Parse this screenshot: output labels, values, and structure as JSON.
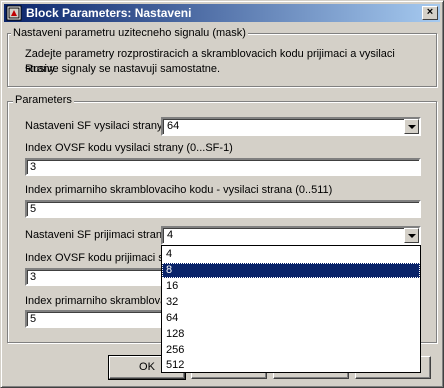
{
  "window": {
    "title": "Block Parameters: Nastaveni",
    "close_glyph": "×"
  },
  "mask": {
    "legend": "Nastaveni parametru uzitecneho signalu (mask)",
    "description_line1": "Zadejte parametry rozprostiracich a skramblovacich kodu prijimaci a vysilaci strany.",
    "description_line2": "Rusive signaly se nastavuji samostatne."
  },
  "parameters": {
    "legend": "Parameters",
    "sf_tx": {
      "label": "Nastaveni SF vysilaci strany",
      "value": "64"
    },
    "ovsf_tx": {
      "label": "Index OVSF kodu vysilaci strany (0...SF-1)",
      "value": "3"
    },
    "scr_tx": {
      "label": "Index primarniho skramblovaciho  kodu - vysilaci strana (0..511)",
      "value": "5"
    },
    "sf_rx": {
      "label": "Nastaveni SF prijimaci strany",
      "value": "4"
    },
    "ovsf_rx": {
      "label": "Index OVSF kodu prijimaci st",
      "value": "3"
    },
    "scr_rx": {
      "label": "Index primarniho skramblovac",
      "value": "5"
    }
  },
  "dropdown": {
    "options": [
      "4",
      "8",
      "16",
      "32",
      "64",
      "128",
      "256",
      "512"
    ],
    "selected": "8"
  },
  "buttons": {
    "ok": "OK"
  }
}
